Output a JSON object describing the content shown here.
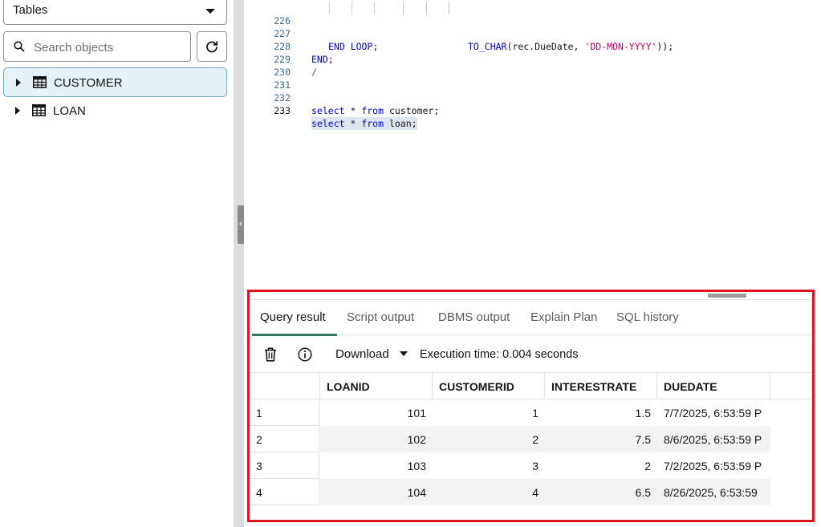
{
  "navigator": {
    "object_type": "Tables",
    "search_placeholder": "Search objects",
    "items": [
      {
        "label": "CUSTOMER",
        "selected": true
      },
      {
        "label": "LOAN",
        "selected": false
      }
    ]
  },
  "editor": {
    "lines": [
      {
        "num": "226"
      },
      {
        "num": "227"
      },
      {
        "num": "228"
      },
      {
        "num": "229"
      },
      {
        "num": "230"
      },
      {
        "num": "231"
      },
      {
        "num": "232"
      },
      {
        "num": "233"
      }
    ],
    "tokens": {
      "l226_fn": "TO_CHAR",
      "l226_a": "(rec.DueDate, ",
      "l226_str": "'DD-MON-YYYY'",
      "l226_b": "));",
      "l227_kw": "END LOOP;",
      "l228_kw": "END;",
      "l229_text": "/",
      "l232_kw1": "select",
      "l232_a": " * ",
      "l232_kw2": "from",
      "l232_b": " customer;",
      "l233_kw1": "select",
      "l233_a": " * ",
      "l233_kw2": "from",
      "l233_b": " loan;"
    }
  },
  "results": {
    "tabs": [
      "Query result",
      "Script output",
      "DBMS output",
      "Explain Plan",
      "SQL history"
    ],
    "active_tab": "Query result",
    "toolbar": {
      "download_label": "Download",
      "execution_time": "Execution time: 0.004 seconds"
    },
    "columns": [
      "LOANID",
      "CUSTOMERID",
      "INTERESTRATE",
      "DUEDATE"
    ],
    "rows": [
      {
        "n": "1",
        "loanid": "101",
        "customerid": "1",
        "interestrate": "1.5",
        "duedate": "7/7/2025, 6:53:59 P"
      },
      {
        "n": "2",
        "loanid": "102",
        "customerid": "2",
        "interestrate": "7.5",
        "duedate": "8/6/2025, 6:53:59 P"
      },
      {
        "n": "3",
        "loanid": "103",
        "customerid": "3",
        "interestrate": "2",
        "duedate": "7/2/2025, 6:53:59 P"
      },
      {
        "n": "4",
        "loanid": "104",
        "customerid": "4",
        "interestrate": "6.5",
        "duedate": "8/26/2025, 6:53:59"
      }
    ]
  },
  "colors": {
    "highlight_border": "#e1141e",
    "active_tab_underline": "#2f7a64",
    "selected_item_bg": "#e4f1f7",
    "keyword": "#0000cc",
    "string": "#c0005f"
  }
}
